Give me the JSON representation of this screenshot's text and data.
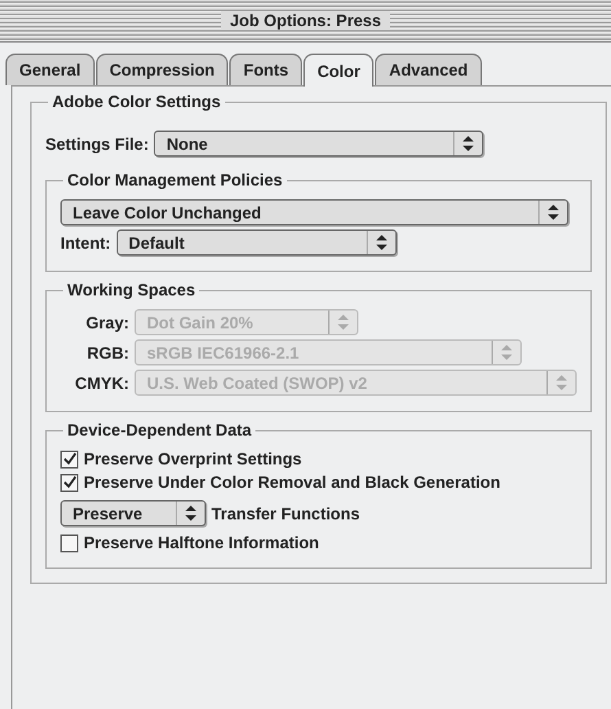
{
  "window": {
    "title": "Job Options: Press"
  },
  "tabs": [
    {
      "label": "General",
      "selected": false
    },
    {
      "label": "Compression",
      "selected": false
    },
    {
      "label": "Fonts",
      "selected": false
    },
    {
      "label": "Color",
      "selected": true
    },
    {
      "label": "Advanced",
      "selected": false
    }
  ],
  "adobe_color_settings": {
    "title": "Adobe Color Settings",
    "settings_file": {
      "label": "Settings File:",
      "value": "None"
    },
    "color_management_policies": {
      "title": "Color Management Policies",
      "policy": {
        "value": "Leave Color Unchanged"
      },
      "intent": {
        "label": "Intent:",
        "value": "Default"
      }
    },
    "working_spaces": {
      "title": "Working Spaces",
      "rows": [
        {
          "label": "Gray:",
          "value": "Dot Gain 20%",
          "disabled": true
        },
        {
          "label": "RGB:",
          "value": "sRGB IEC61966-2.1",
          "disabled": true
        },
        {
          "label": "CMYK:",
          "value": "U.S. Web Coated (SWOP) v2",
          "disabled": true
        }
      ]
    },
    "device_dependent_data": {
      "title": "Device-Dependent Data",
      "items": [
        {
          "kind": "checkbox",
          "label": "Preserve Overprint Settings",
          "checked": true
        },
        {
          "kind": "checkbox",
          "label": "Preserve Under Color Removal and Black Generation",
          "checked": true
        },
        {
          "kind": "popup",
          "option": "Preserve",
          "caption": "Transfer Functions"
        },
        {
          "kind": "checkbox",
          "label": "Preserve Halftone Information",
          "checked": false
        }
      ]
    }
  }
}
